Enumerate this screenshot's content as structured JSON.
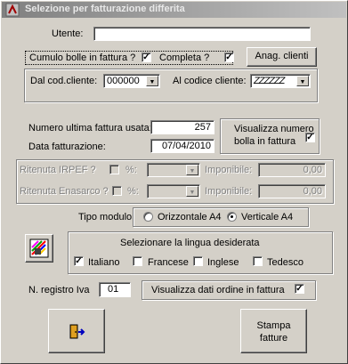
{
  "window": {
    "title": "Selezione per fatturazione differita"
  },
  "utente": {
    "label": "Utente:",
    "value": ""
  },
  "cumulo_bolle": {
    "label": "Cumulo bolle in fattura ?",
    "checked": true
  },
  "completa": {
    "label": "Completa ?",
    "checked": true
  },
  "anag_clienti_button": {
    "label": "Anag. clienti"
  },
  "dal_cod_cliente": {
    "label": "Dal cod.cliente:",
    "value": "000000"
  },
  "al_codice_cliente": {
    "label": "Al codice cliente:",
    "value": "ZZZZZZ"
  },
  "numero_ultima_fattura": {
    "label": "Numero ultima fattura usata:",
    "value": "257"
  },
  "data_fatturazione": {
    "label": "Data fatturazione:",
    "value": "07/04/2010"
  },
  "visualizza_numero_bolla": {
    "label_line1": "Visualizza numero",
    "label_line2": "bolla in fattura",
    "checked": true
  },
  "ritenuta_irpef": {
    "label": "Ritenuta IRPEF ?",
    "pct": "%:",
    "imponibile_label": "Imponibile:",
    "imponibile_value": "0,00"
  },
  "ritenuta_enasarco": {
    "label": "Ritenuta Enasarco ?",
    "pct": "%:",
    "imponibile_label": "Imponibile:",
    "imponibile_value": "0,00"
  },
  "tipo_modulo": {
    "label": "Tipo modulo",
    "options": [
      "Orizzontale A4",
      "Verticale A4"
    ],
    "selected": "Verticale A4"
  },
  "lingua": {
    "title": "Selezionare la lingua desiderata",
    "options": [
      {
        "label": "Italiano",
        "checked": true
      },
      {
        "label": "Francese",
        "checked": false
      },
      {
        "label": "Inglese",
        "checked": false
      },
      {
        "label": "Tedesco",
        "checked": false
      }
    ]
  },
  "registro_iva": {
    "label": "N. registro Iva",
    "value": "01"
  },
  "visualizza_dati_ordine": {
    "label": "Visualizza dati ordine in fattura",
    "checked": true
  },
  "stampa_button": {
    "line1": "Stampa",
    "line2": "fatture"
  },
  "exit_button": {
    "icon": "exit-door-icon"
  },
  "colors": {
    "face": "#d4d0c8",
    "shadow": "#808080",
    "highlight": "#ffffff",
    "titlebar_start": "#808080"
  }
}
